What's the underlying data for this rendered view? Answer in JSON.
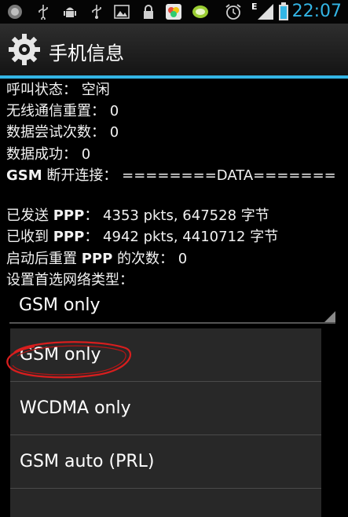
{
  "status_bar": {
    "time": "22:07",
    "network_type": "E",
    "icons": [
      "android-icon",
      "usb-icon",
      "android-debug-icon",
      "usb-icon",
      "image-icon",
      "lock-icon",
      "gallery-icon",
      "chat-icon",
      "alarm-icon",
      "signal-icon",
      "battery-icon"
    ]
  },
  "title_bar": {
    "title": "手机信息",
    "icon": "gear-icon"
  },
  "info": {
    "call_status_label": "呼叫状态：",
    "call_status_value": "空闲",
    "radio_reset_label": "无线通信重置：",
    "radio_reset_value": "0",
    "data_attempts_label": "数据尝试次数：",
    "data_attempts_value": "0",
    "data_success_label": "数据成功：",
    "data_success_value": "0",
    "gsm_disconnect_label_bold": "GSM",
    "gsm_disconnect_label": "断开连接：",
    "gsm_disconnect_value": "========DATA=======",
    "ppp_sent_label": "已发送",
    "ppp_sent_bold": "PPP",
    "ppp_sent_value": "4353 pkts, 647528 字节",
    "ppp_recv_label": "已收到",
    "ppp_recv_bold": "PPP",
    "ppp_recv_value": "4942 pkts, 4410712 字节",
    "ppp_reset_label": "启动后重置",
    "ppp_reset_bold": "PPP",
    "ppp_reset_label2": "的次数：",
    "ppp_reset_value": "0",
    "preferred_network_label": "设置首选网络类型："
  },
  "spinner": {
    "selected": "GSM only"
  },
  "dropdown": {
    "options": [
      "GSM only",
      "WCDMA only",
      "GSM auto (PRL)"
    ]
  },
  "colors": {
    "accent": "#33b5e5",
    "annotation": "#d81e1e"
  }
}
